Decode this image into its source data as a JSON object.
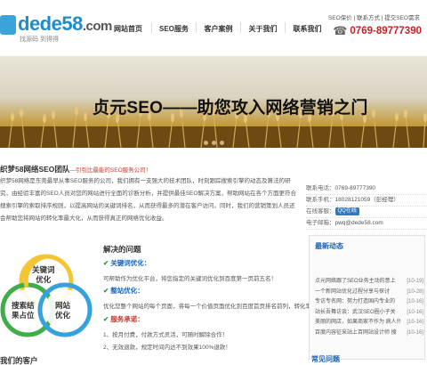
{
  "header": {
    "logo": {
      "brand": "dede",
      "number": "58",
      "tld": ".com",
      "slogan": "找源码 到得得"
    },
    "nav": [
      {
        "label": "网站首页"
      },
      {
        "label": "SEO服务"
      },
      {
        "label": "客户案例"
      },
      {
        "label": "关于我们"
      },
      {
        "label": "联系我们"
      }
    ],
    "top_links": "SEO保价 | 联系方式 | 提交SEO需求",
    "phone": "0769-89777390"
  },
  "banner": {
    "title": "贞元SEO——助您攻入网络营销之门"
  },
  "intro": {
    "title": "织梦58网络SEO团队",
    "subtitle": "—引引比最能的SEO服务公司！",
    "body": "织梦58网络是东莞最早从事SEO服务的公司，我们拥有一支强大的技术团队，时刻跟踪搜索引擎的动态及算法的研究，由经验丰富的SEO人员对您的网站进行全面的诊断分析，并提供最佳SEO解决方案，帮助网站在各个方面更符合搜索引擎的索取排序规则，以提高网站的关键词排名，从而获得最多的潜在客户访问。同时，我们的营销策划人员还会帮助您将网站的转化率最大化，从而获得真正的网络优化收益。"
  },
  "contact": {
    "rows": [
      {
        "label": "联系电话：",
        "value": "0769-89777390"
      },
      {
        "label": "联系手机：",
        "value": "18028121059（彭经理）"
      },
      {
        "label": "在线客服：",
        "value": "QQ在线"
      },
      {
        "label": "电子邮箱：",
        "value": "pwq@dede58.com"
      }
    ]
  },
  "circles": {
    "top": "关键词\n优化",
    "left": "搜索结\n果占位",
    "right": "网站\n优化"
  },
  "solution": {
    "title": "解决的问题",
    "items": [
      {
        "heading": "关键词优化：",
        "text": "可帮助作为优化平台，将您指定的关键词优化到百度第一页前五名！"
      },
      {
        "heading": "整站优化：",
        "text": "优化您整个网站的每个页面，将每一个价值页面优化到百度首页排名前列，转化率更高！"
      },
      {
        "heading": "服务承诺：",
        "lines": [
          "1、按月付费，付款方式灵活，可随时解除合作！",
          "2、无效退款，规定时间内达不到效果100%退款！"
        ]
      }
    ]
  },
  "clients_title": "我们的客户",
  "news": {
    "title": "最新动态",
    "items": [
      {
        "title": "点元网络跟了SEO业务主动的意上",
        "date": "[10-19]"
      },
      {
        "title": "一个新网站优化过程分享与探讨",
        "date": "[10-28]"
      },
      {
        "title": "专访专名网：努力打造国内专业的",
        "date": "[10-16]"
      },
      {
        "title": "站长吾舞访谈：武汉SEO圈小子关",
        "date": "[10-16]"
      },
      {
        "title": "美丽的网店，如果商家不作为 病人代",
        "date": "[10-16]"
      },
      {
        "title": "百度内容征采站上百网站设计师 搜",
        "date": "[10-16]"
      }
    ]
  },
  "faq_title": "常见问题",
  "colors": {
    "brand_blue": "#1e8ccc",
    "phone_red": "#c32127",
    "accent_blue": "#1b64b5"
  }
}
